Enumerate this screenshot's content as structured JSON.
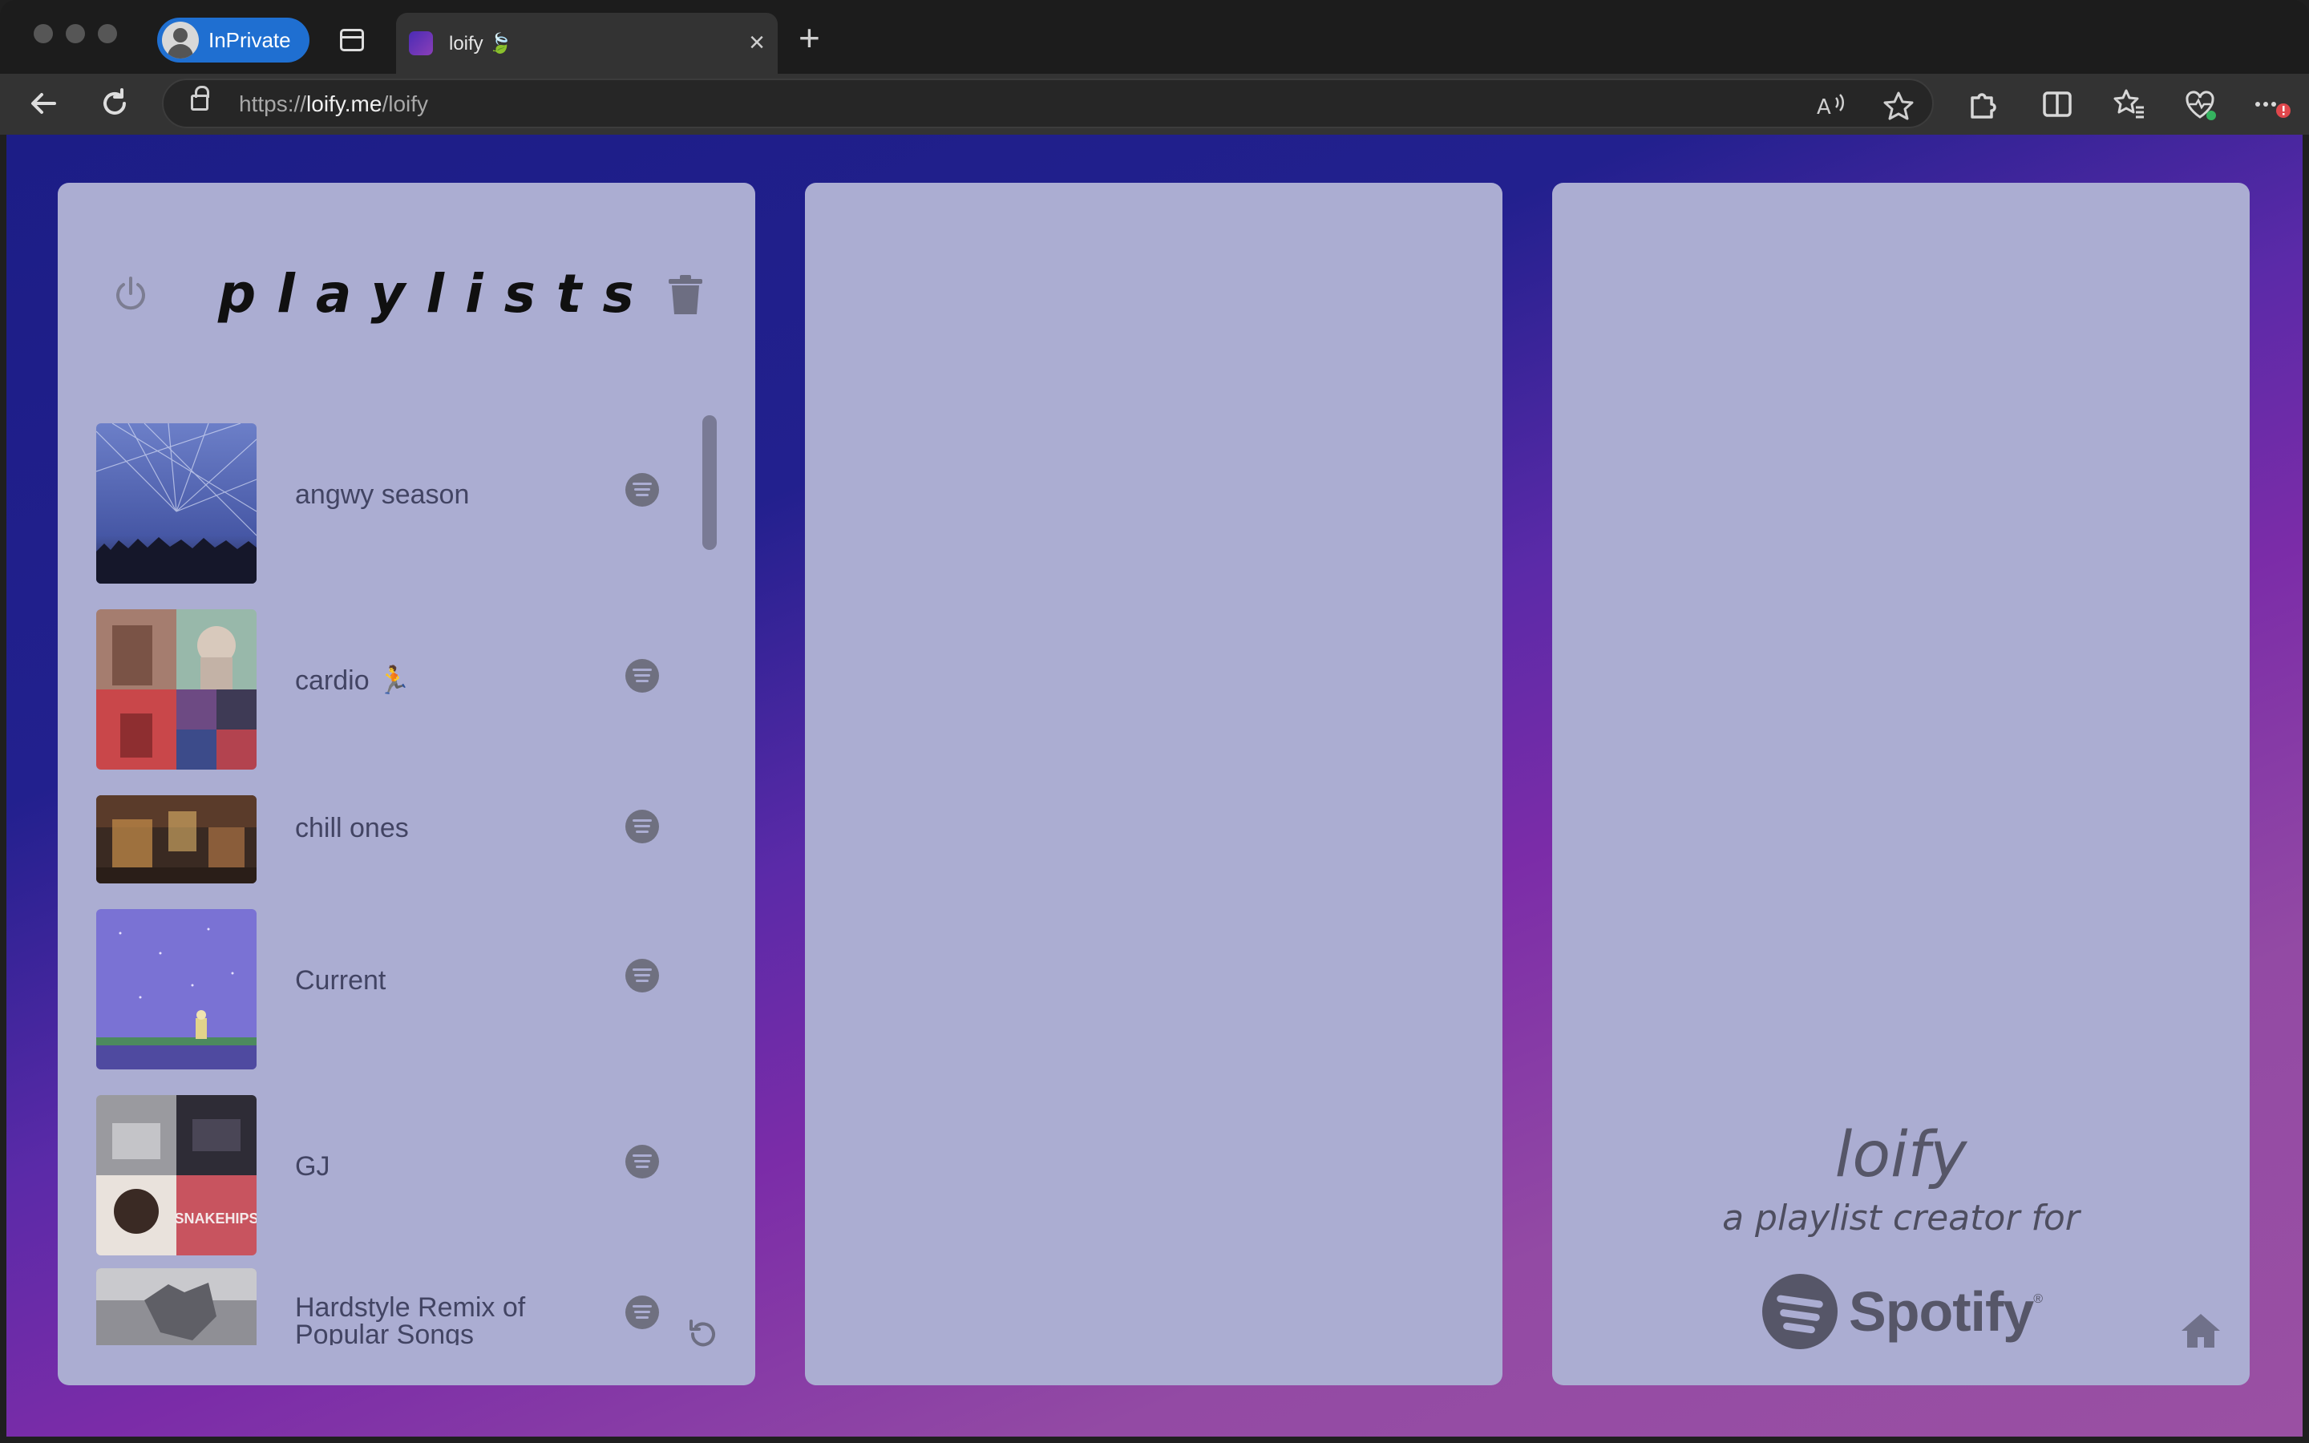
{
  "browser": {
    "inprivate_label": "InPrivate",
    "tab_title": "loify 🍃",
    "tab_close": "×",
    "new_tab": "+",
    "url_prefix": "https://",
    "url_host": "loify.me",
    "url_path": "/loify",
    "icons": [
      "back-icon",
      "refresh-icon",
      "lock-icon",
      "read-aloud-icon",
      "favorite-star-icon",
      "extensions-icon",
      "split-screen-icon",
      "favorites-icon",
      "browser-essentials-icon",
      "more-icon"
    ]
  },
  "left_panel": {
    "title": "playlists",
    "playlists": [
      {
        "name": "angwy season",
        "art": "concert-lights"
      },
      {
        "name": "cardio 🏃",
        "art": "collage-warm"
      },
      {
        "name": "chill ones",
        "art": "room-amber"
      },
      {
        "name": "Current",
        "art": "purple-sky"
      },
      {
        "name": "GJ",
        "art": "collage-dark"
      },
      {
        "name": "Hardstyle Remix of Popular Songs",
        "art": "gray-statue"
      }
    ]
  },
  "right_panel": {
    "brand_name": "loify",
    "tagline": "a playlist creator for",
    "spotify_word": "Spotify",
    "spotify_reg": "®"
  },
  "colors": {
    "panel": "#abadd2",
    "gradient_start": "#1c1d86",
    "gradient_end": "#9a50a3",
    "text_dark": "#424463"
  }
}
